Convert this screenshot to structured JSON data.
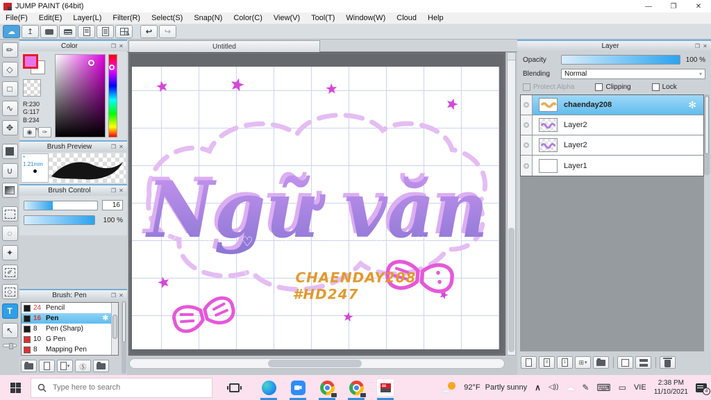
{
  "window": {
    "title": "JUMP PAINT (64bit)",
    "minimize": "—",
    "restore": "❐",
    "close": "✕"
  },
  "menu": {
    "items": [
      "File(F)",
      "Edit(E)",
      "Layer(L)",
      "Filter(R)",
      "Select(S)",
      "Snap(N)",
      "Color(C)",
      "View(V)",
      "Tool(T)",
      "Window(W)",
      "Cloud",
      "Help"
    ]
  },
  "toolbar": {
    "cloud": "☁",
    "upload": "↥",
    "undo": "↩",
    "redo": "↪"
  },
  "icons": {
    "brush": "✏",
    "eraser": "◇",
    "shape": "□",
    "curve": "∿",
    "move": "✥",
    "bucket": "∪",
    "lasso": "◌",
    "wand": "✦",
    "select_pen": "✐",
    "select_eraser": "◇",
    "text": "T",
    "operation": "↖",
    "gear": "✻",
    "popout": "❐",
    "close": "✕",
    "palette": "◉",
    "picker": "✑",
    "cloud_dl": "☁",
    "s_page": "Ⓢ",
    "chevron_up": "∧",
    "speaker": "◁))",
    "tray_cloud": "☁",
    "tray_pen": "✎",
    "keyboard": "⌨",
    "touchpad": "▭",
    "star_prefix": "*"
  },
  "colors": {
    "accent_blue": "#2f9fe8",
    "selection": "#8fd2f4",
    "foreground": "#E675EA",
    "magenta_star": "#d448d8",
    "purple_letter": "#a584de",
    "credit_orange": "#e09a2e",
    "taskbar_pink": "#fbe2ee"
  },
  "color_panel": {
    "title": "Color",
    "r": "R:230",
    "g": "G:117",
    "b": "B:234",
    "hex": "#E675EA"
  },
  "brush_preview": {
    "title": "Brush Preview",
    "size": "1.21mm"
  },
  "brush_control": {
    "title": "Brush Control",
    "size_value": "16",
    "opacity_value": "100 %"
  },
  "brush_panel": {
    "title": "Brush: Pen",
    "brushes": [
      {
        "size": "24",
        "name": "Pencil"
      },
      {
        "size": "16",
        "name": "Pen"
      },
      {
        "size": "8",
        "name": "Pen (Sharp)"
      },
      {
        "size": "10",
        "name": "G Pen"
      },
      {
        "size": "8",
        "name": "Mapping Pen"
      }
    ]
  },
  "canvas": {
    "tab": "Untitled",
    "artwork": {
      "title": "Ngữ văn",
      "credit1": "CHAENDAY208",
      "credit2": "#HD247"
    }
  },
  "layer_panel": {
    "title": "Layer",
    "opacity_label": "Opacity",
    "opacity_value": "100 %",
    "blending_label": "Blending",
    "blending_value": "Normal",
    "protect_alpha": "Protect Alpha",
    "clipping": "Clipping",
    "lock": "Lock",
    "btn_8": "8",
    "btn_1": "1",
    "layers": [
      {
        "name": "chaenday208"
      },
      {
        "name": "Layer2"
      },
      {
        "name": "Layer2"
      },
      {
        "name": "Layer1"
      }
    ]
  },
  "taskbar": {
    "search_placeholder": "Type here to search",
    "weather_temp": "92°F",
    "weather_desc": "Partly sunny",
    "language": "VIE",
    "time": "2:38 PM",
    "date": "11/10/2021",
    "notification_count": "4"
  }
}
